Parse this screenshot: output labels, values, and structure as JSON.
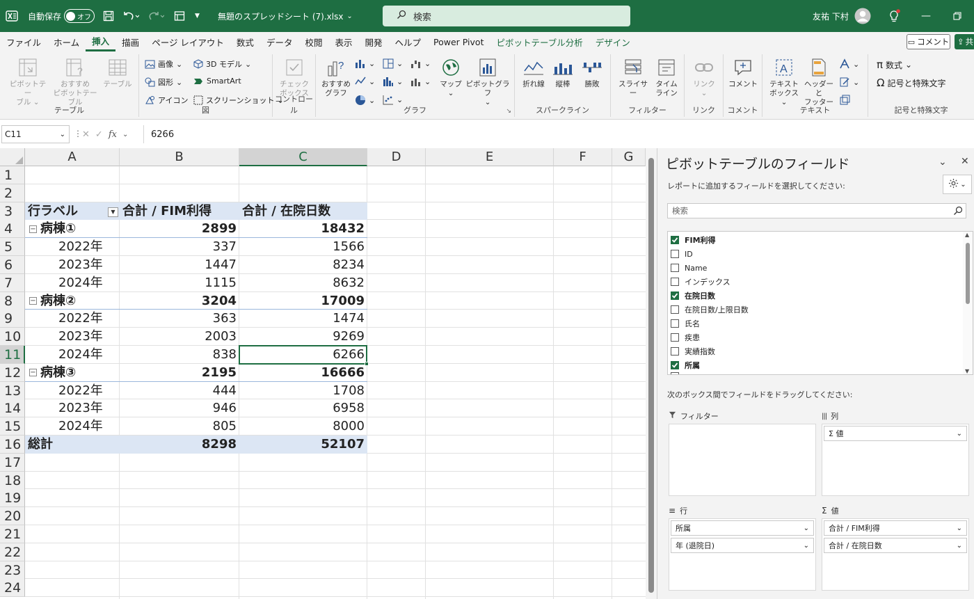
{
  "titlebar": {
    "autosave_label": "自動保存",
    "autosave_state": "オフ",
    "filename": "無題のスプレッドシート (7).xlsx",
    "search_placeholder": "検索",
    "user_name": "友祐 下村"
  },
  "tabs": [
    "ファイル",
    "ホーム",
    "挿入",
    "描画",
    "ページ レイアウト",
    "数式",
    "データ",
    "校閲",
    "表示",
    "開発",
    "ヘルプ",
    "Power Pivot",
    "ピボットテーブル分析",
    "デザイン"
  ],
  "active_tab": "挿入",
  "ribbon_right": {
    "comment_label": "コメント",
    "share_label": "共"
  },
  "ribbon": {
    "table_group": {
      "label": "テーブル",
      "pivot_l1": "ピボットテー",
      "pivot_l2": "ブル",
      "rec_l1": "おすすめ",
      "rec_l2": "ピボットテーブル",
      "table": "テーブル"
    },
    "illust_group": {
      "label": "図",
      "image": "画像",
      "shape": "図形",
      "icon": "アイコン",
      "model3d": "3D モデル",
      "smartart": "SmartArt",
      "screenshot": "スクリーンショット"
    },
    "control_group": {
      "label": "コントロール",
      "check_l1": "チェック",
      "check_l2": "ボックス"
    },
    "chart_group": {
      "label": "グラフ",
      "rec_l1": "おすすめ",
      "rec_l2": "グラフ",
      "map": "マップ",
      "pivotchart": "ピボットグラフ"
    },
    "spark_group": {
      "label": "スパークライン",
      "line": "折れ線",
      "column": "縦棒",
      "winloss": "勝敗"
    },
    "filter_group": {
      "label": "フィルター",
      "slicer": "スライサー",
      "timeline_l1": "タイム",
      "timeline_l2": "ライン"
    },
    "link_group": {
      "label": "リンク",
      "link": "リンク"
    },
    "comment_group": {
      "label": "コメント",
      "comment": "コメント"
    },
    "text_group": {
      "label": "テキスト",
      "textbox_l1": "テキスト",
      "textbox_l2": "ボックス",
      "header_l1": "ヘッダーと",
      "header_l2": "フッター"
    },
    "symbol_group": {
      "label": "記号と特殊文字",
      "equation": "数式",
      "symbol": "記号と特殊文字"
    }
  },
  "formula_bar": {
    "name_box": "C11",
    "fx": "fx",
    "value": "6266"
  },
  "columns": [
    "A",
    "B",
    "C",
    "D",
    "E",
    "F",
    "G"
  ],
  "rows": [
    "1",
    "2",
    "3",
    "4",
    "5",
    "6",
    "7",
    "8",
    "9",
    "10",
    "11",
    "12",
    "13",
    "14",
    "15",
    "16",
    "17",
    "18",
    "19",
    "20",
    "21",
    "22",
    "23",
    "24"
  ],
  "pivot": {
    "header": {
      "a": "行ラベル",
      "b": "合計 / FIM利得",
      "c": "合計 / 在院日数"
    },
    "groups": [
      {
        "name": "病棟①",
        "b": "2899",
        "c": "18432",
        "items": [
          {
            "year": "2022年",
            "b": "337",
            "c": "1566"
          },
          {
            "year": "2023年",
            "b": "1447",
            "c": "8234"
          },
          {
            "year": "2024年",
            "b": "1115",
            "c": "8632"
          }
        ]
      },
      {
        "name": "病棟②",
        "b": "3204",
        "c": "17009",
        "items": [
          {
            "year": "2022年",
            "b": "363",
            "c": "1474"
          },
          {
            "year": "2023年",
            "b": "2003",
            "c": "9269"
          },
          {
            "year": "2024年",
            "b": "838",
            "c": "6266"
          }
        ]
      },
      {
        "name": "病棟③",
        "b": "2195",
        "c": "16666",
        "items": [
          {
            "year": "2022年",
            "b": "444",
            "c": "1708"
          },
          {
            "year": "2023年",
            "b": "946",
            "c": "6958"
          },
          {
            "year": "2024年",
            "b": "805",
            "c": "8000"
          }
        ]
      }
    ],
    "total": {
      "a": "総計",
      "b": "8298",
      "c": "52107"
    },
    "collapse_glyph": "−"
  },
  "pane": {
    "title": "ピボットテーブルのフィールド",
    "subtitle": "レポートに追加するフィールドを選択してください:",
    "search_placeholder": "検索",
    "fields": [
      {
        "label": "FIM利得",
        "checked": true
      },
      {
        "label": "ID",
        "checked": false
      },
      {
        "label": "Name",
        "checked": false
      },
      {
        "label": "インデックス",
        "checked": false
      },
      {
        "label": "在院日数",
        "checked": true
      },
      {
        "label": "在院日数/上限日数",
        "checked": false
      },
      {
        "label": "氏名",
        "checked": false
      },
      {
        "label": "疾患",
        "checked": false
      },
      {
        "label": "実績指数",
        "checked": false
      },
      {
        "label": "所属",
        "checked": true
      }
    ],
    "drag_hint": "次のボックス間でフィールドをドラッグしてください:",
    "areas": {
      "filter": {
        "label": "フィルター",
        "items": []
      },
      "columns": {
        "label": "列",
        "items": [
          "Σ 値"
        ]
      },
      "rows": {
        "label": "行",
        "items": [
          "所属",
          "年 (退院日)"
        ]
      },
      "values": {
        "label": "値",
        "items": [
          "合計 / FIM利得",
          "合計 / 在院日数"
        ]
      }
    }
  },
  "colors": {
    "brand": "#1e6e42",
    "pivot_header": "#dce6f4"
  }
}
